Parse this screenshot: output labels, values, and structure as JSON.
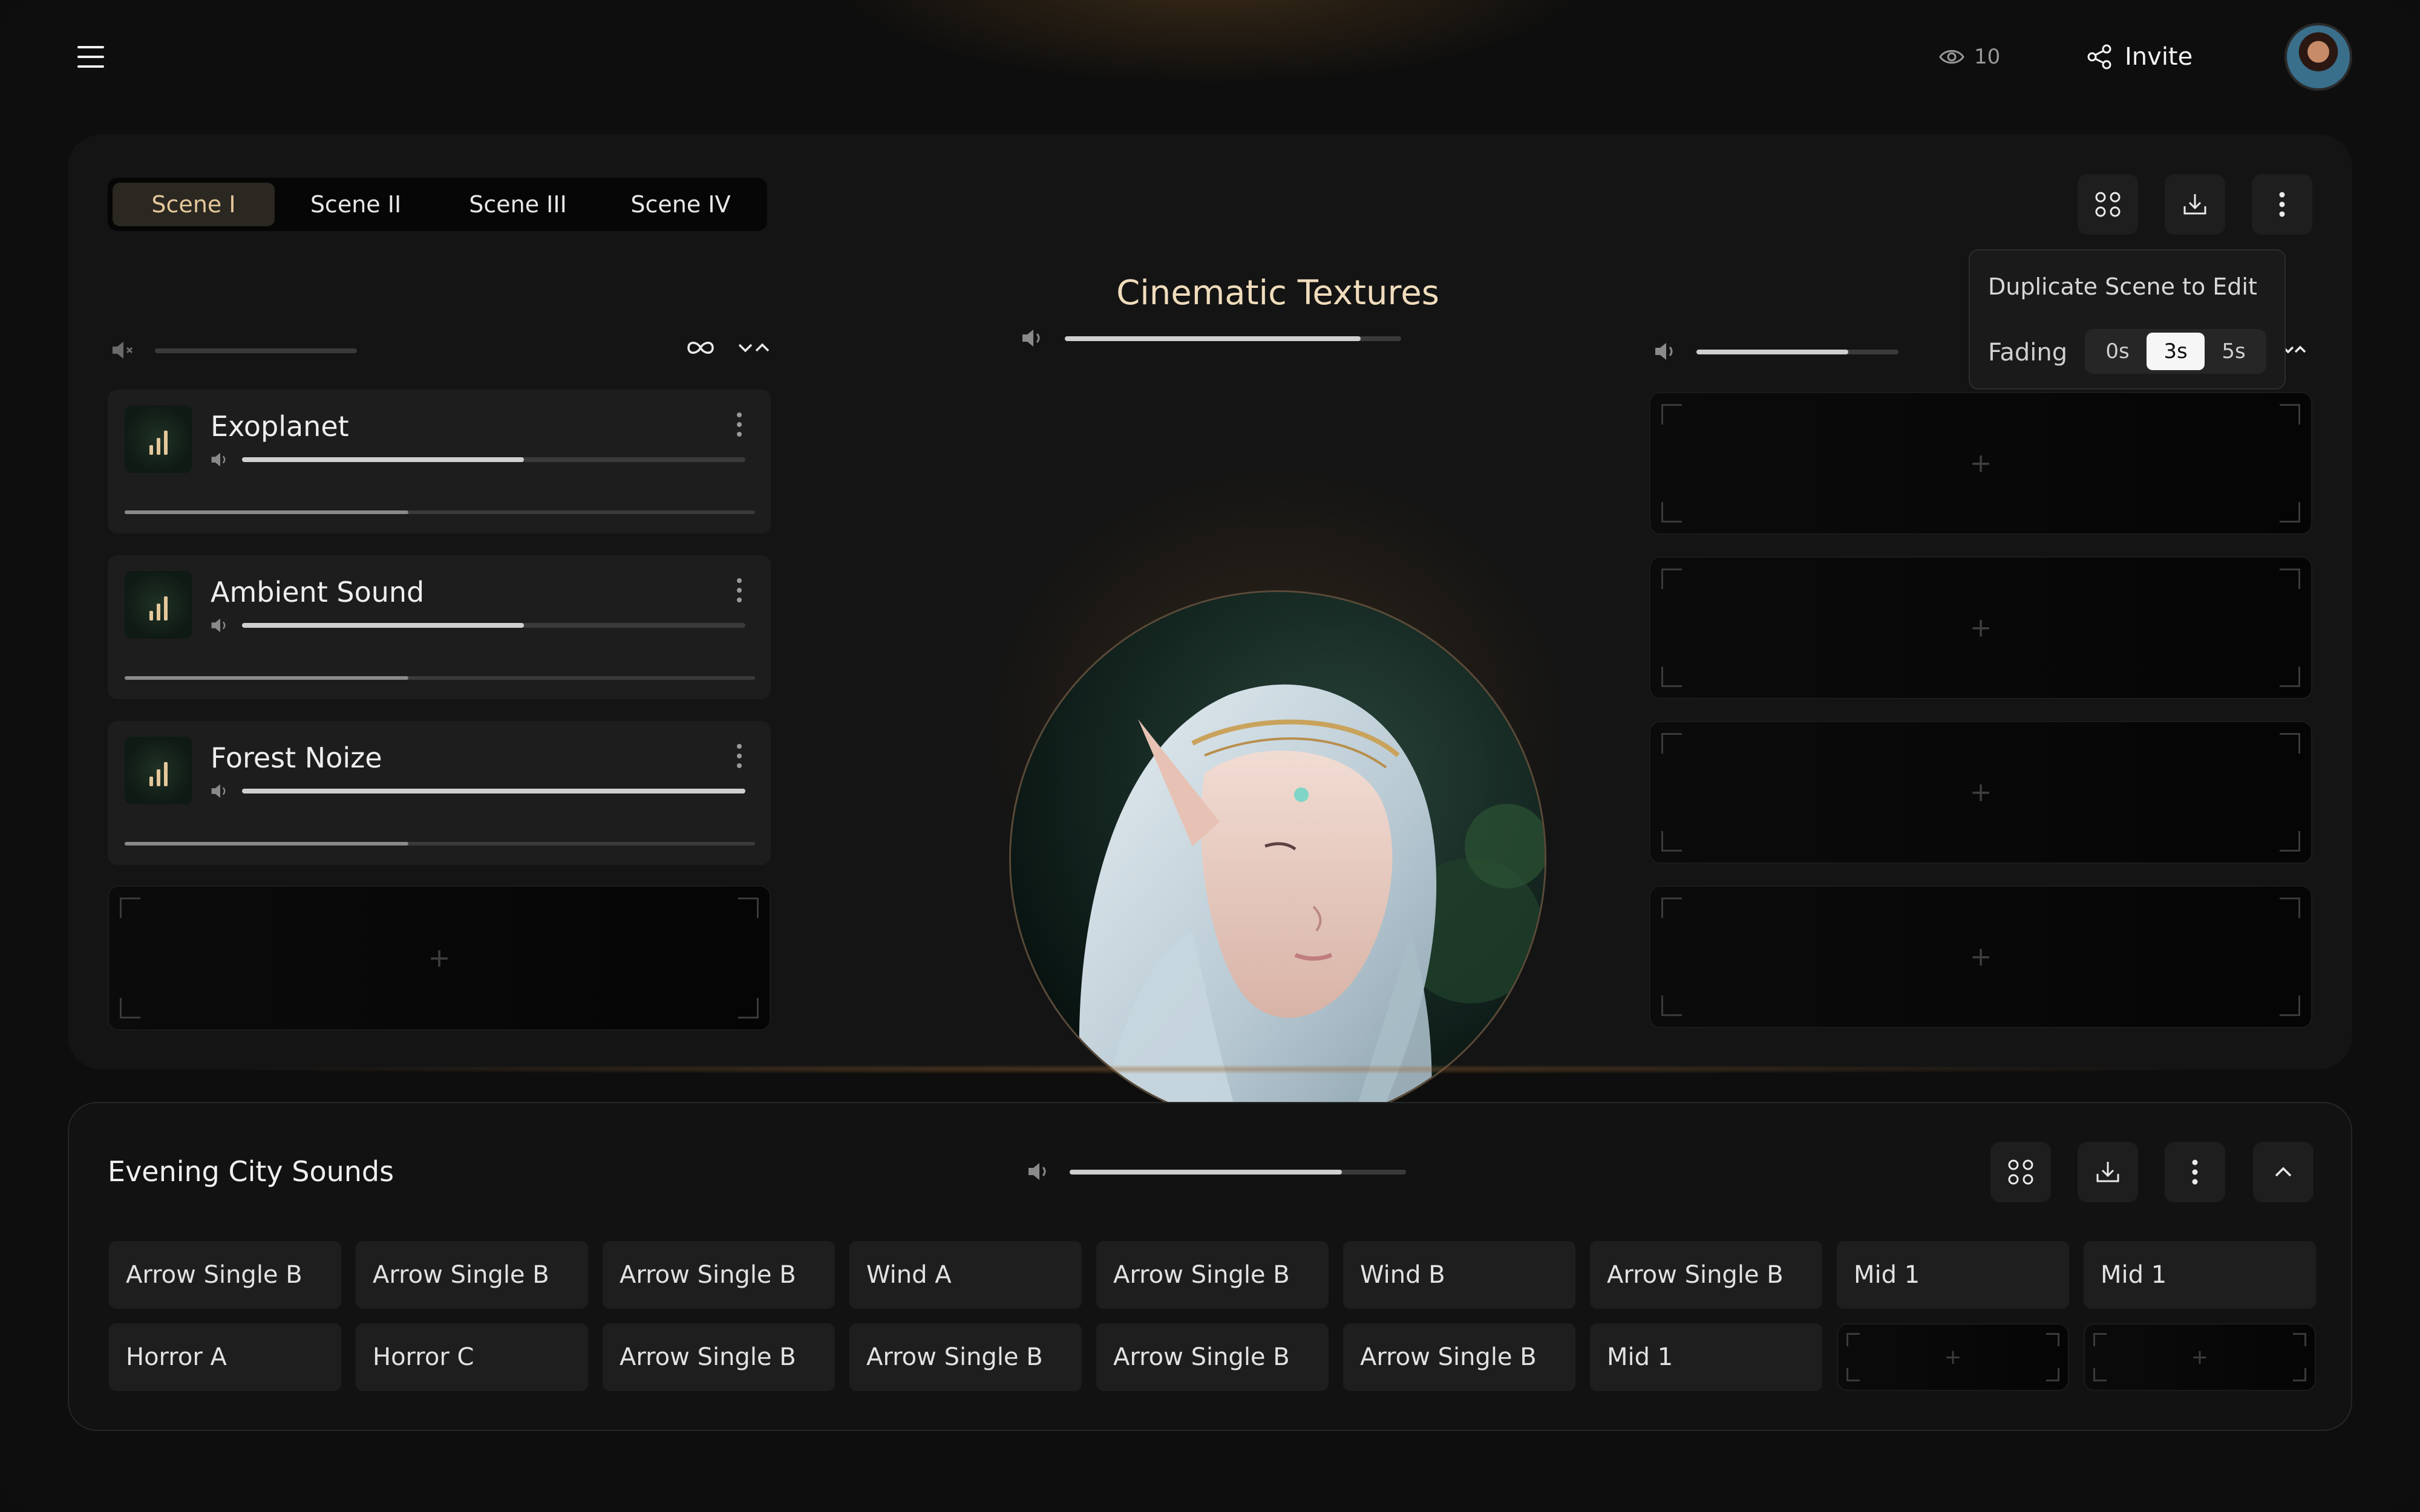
{
  "header": {
    "viewer_count": "10",
    "invite_label": "Invite"
  },
  "scene_tabs": [
    {
      "label": "Scene I",
      "active": true
    },
    {
      "label": "Scene II",
      "active": false
    },
    {
      "label": "Scene III",
      "active": false
    },
    {
      "label": "Scene IV",
      "active": false
    }
  ],
  "scene": {
    "title": "Cinematic Textures",
    "master_volume": 0.88,
    "left_volume": 0.0,
    "right_volume": 0.75
  },
  "tracks": [
    {
      "name": "Exoplanet",
      "volume": 0.56,
      "progress": 0.45
    },
    {
      "name": "Ambient Sound",
      "volume": 0.56,
      "progress": 0.45
    },
    {
      "name": "Forest Noize",
      "volume": 1.0,
      "progress": 0.45
    }
  ],
  "popover": {
    "duplicate_label": "Duplicate Scene to Edit",
    "fading_label": "Fading",
    "fade_options": [
      "0s",
      "3s",
      "5s"
    ],
    "fade_selected": "3s"
  },
  "bottom": {
    "title": "Evening City Sounds",
    "volume": 0.81,
    "pads_row1": [
      "Arrow Single B",
      "Arrow Single B",
      "Arrow Single B",
      "Wind A",
      "Arrow Single B",
      "Wind B",
      "Arrow Single B",
      "Mid 1",
      "Mid 1"
    ],
    "pads_row2": [
      "Horror A",
      "Horror C",
      "Arrow Single B",
      "Arrow Single B",
      "Arrow Single B",
      "Arrow Single B",
      "Mid 1"
    ]
  },
  "colors": {
    "accent": "#e4c79b",
    "background": "#0e0e0e",
    "panel": "#141414"
  },
  "icons": {
    "menu": "hamburger-icon",
    "viewers": "eye-icon",
    "invite": "share-icon",
    "grid": "grid-icon",
    "download": "download-icon",
    "more": "more-vertical-icon",
    "loop": "infinity-icon",
    "collapse": "chevron-up-icon"
  }
}
